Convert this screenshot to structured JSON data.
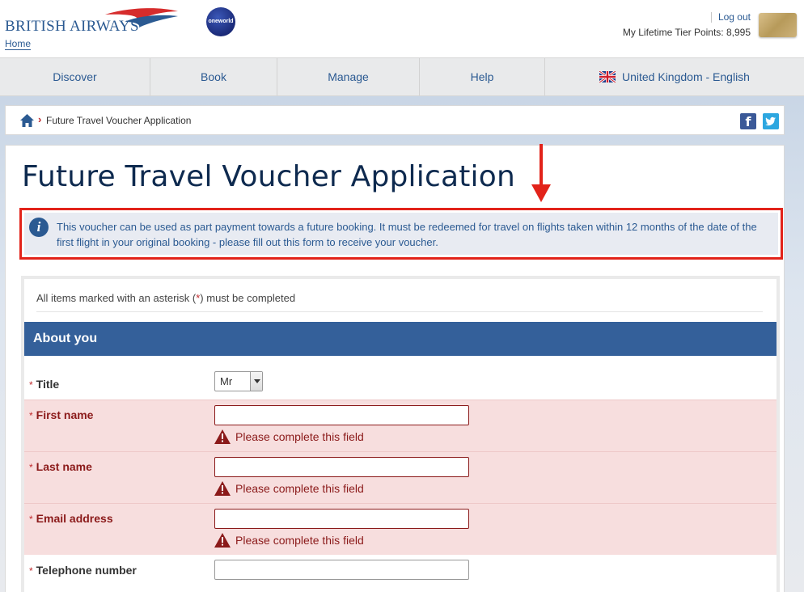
{
  "header": {
    "brand": "BRITISH AIRWAYS",
    "home_link": "Home",
    "oneworld": "oneworld",
    "logout": "Log out",
    "tier_points": "My Lifetime Tier Points: 8,995"
  },
  "nav": {
    "items": [
      {
        "label": "Discover"
      },
      {
        "label": "Book"
      },
      {
        "label": "Manage"
      },
      {
        "label": "Help"
      },
      {
        "label": "United Kingdom - English",
        "icon": "uk-flag-icon"
      }
    ]
  },
  "breadcrumb": {
    "separator": "›",
    "current": "Future Travel Voucher Application"
  },
  "main": {
    "title": "Future Travel Voucher Application",
    "info": "This voucher can be used as part payment towards a future booking. It must be redeemed for travel on flights taken within 12 months of the date of the first flight in your original booking - please fill out this form to receive your voucher.",
    "highlight_color": "#e2231a"
  },
  "form": {
    "required_note_prefix": "All items marked with an asterisk (",
    "asterisk": "*",
    "required_note_suffix": ") must be completed",
    "section_title": "About you",
    "title_field": {
      "label": "Title",
      "value": "Mr"
    },
    "first_name": {
      "label": "First name",
      "value": "",
      "error": "Please complete this field"
    },
    "last_name": {
      "label": "Last name",
      "value": "",
      "error": "Please complete this field"
    },
    "email": {
      "label": "Email address",
      "value": "",
      "error": "Please complete this field"
    },
    "telephone": {
      "label": "Telephone number",
      "value": ""
    }
  }
}
